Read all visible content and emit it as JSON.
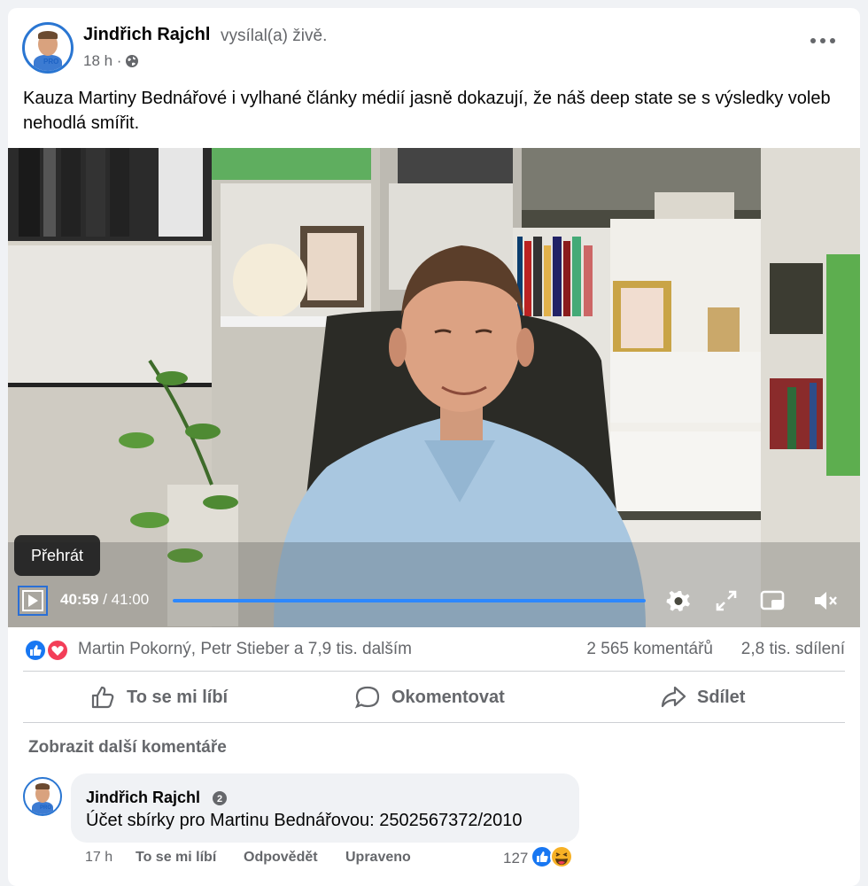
{
  "post": {
    "author": "Jindřich Rajchl",
    "action": "vysílal(a) živě.",
    "time": "18 h ·",
    "text": "Kauza Martiny Bednářové i vylhané články médií jasně dokazují, že náš deep state se s výsledky voleb nehodlá smířit.",
    "avatar_tag": "PRO"
  },
  "video": {
    "tooltip": "Přehrát",
    "current_time": "40:59",
    "separator": " / ",
    "duration": "41:00",
    "progress_fraction": 0.9996
  },
  "reactions": {
    "names": "Martin Pokorný, Petr Stieber a 7,9 tis. dalším",
    "comments": "2 565 komentářů",
    "shares": "2,8 tis. sdílení"
  },
  "actions": {
    "like": "To se mi líbí",
    "comment": "Okomentovat",
    "share": "Sdílet"
  },
  "comments_section": {
    "more_comments": "Zobrazit další komentáře",
    "comment": {
      "author": "Jindřich Rajchl",
      "text": "Účet sbírky pro Martinu Bednářovou: 2502567372/2010",
      "time": "17 h",
      "like": "To se mi líbí",
      "reply": "Odpovědět",
      "edited": "Upraveno",
      "reaction_count": "127"
    }
  },
  "colors": {
    "accent": "#2d88ff",
    "like_blue": "#1877f2",
    "love_red": "#f33e58",
    "muted": "#65676b"
  },
  "icons": [
    "globe-icon",
    "more-icon",
    "play-icon",
    "settings-icon",
    "fullscreen-icon",
    "pip-icon",
    "mute-icon",
    "like-icon",
    "love-icon",
    "comment-icon",
    "share-icon",
    "haha-icon",
    "top-fan-badge-icon"
  ]
}
